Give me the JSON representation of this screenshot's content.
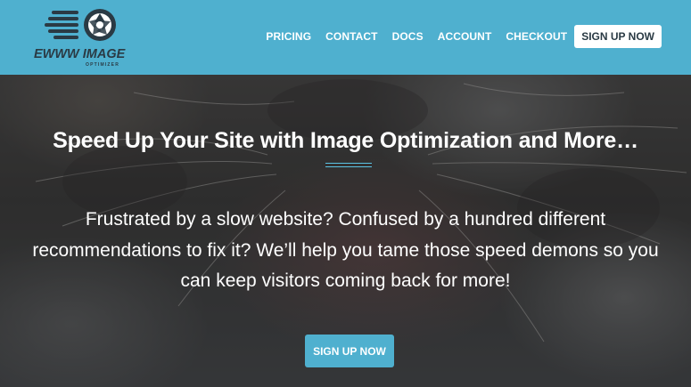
{
  "brand": {
    "logo_main": "EWWW IMAGE",
    "logo_sub": "OPTIMIZER",
    "accent": "#4fb0cf"
  },
  "nav": {
    "items": [
      "PRICING",
      "CONTACT",
      "DOCS",
      "ACCOUNT",
      "CHECKOUT"
    ],
    "signup_label": "SIGN UP NOW"
  },
  "hero": {
    "title": "Speed Up Your Site with Image Optimization and More…",
    "description": "Frustrated by a slow website? Confused by a hundred different recommendations to fix it? We’ll help you tame those speed demons so you can keep visitors coming back for more!",
    "cta_label": "SIGN UP NOW"
  }
}
